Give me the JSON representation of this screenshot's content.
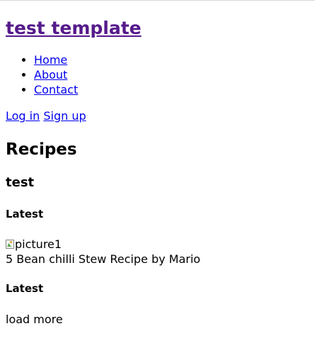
{
  "header": {
    "site_title": "test template"
  },
  "nav": {
    "items": [
      {
        "label": "Home"
      },
      {
        "label": "About"
      },
      {
        "label": "Contact"
      }
    ]
  },
  "auth": {
    "login_label": "Log in",
    "signup_label": "Sign up"
  },
  "main": {
    "section_title": "Recipes",
    "subtitle": "test",
    "latest_heading_1": "Latest",
    "recipe": {
      "image_alt": "picture1",
      "caption": "5 Bean chilli Stew Recipe by Mario"
    },
    "latest_heading_2": "Latest",
    "load_more_label": "load more"
  },
  "colors": {
    "link": "#0000ee",
    "visited_link": "#551a8b",
    "text": "#000000",
    "background": "#ffffff"
  }
}
